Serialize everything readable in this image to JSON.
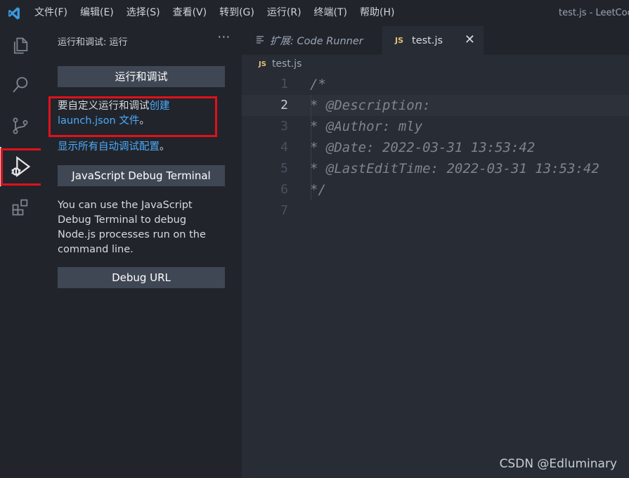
{
  "titlebar": {
    "menu": [
      "文件(F)",
      "编辑(E)",
      "选择(S)",
      "查看(V)",
      "转到(G)",
      "运行(R)",
      "终端(T)",
      "帮助(H)"
    ],
    "window_title": "test.js - LeetCode"
  },
  "activitybar": {
    "items": [
      "explorer-icon",
      "search-icon",
      "source-control-icon",
      "run-debug-icon",
      "extensions-icon"
    ],
    "active": "run-debug-icon"
  },
  "sidebar": {
    "title": "运行和调试: 运行",
    "more": "···",
    "run_button": "运行和调试",
    "customize_prefix": "要自定义运行和调试",
    "customize_link": "创建 launch.json 文件",
    "customize_suffix": "。",
    "show_all_link": "显示所有自动调试配置",
    "show_all_suffix": "。",
    "terminal_button": "JavaScript Debug Terminal",
    "terminal_desc": "You can use the JavaScript Debug Terminal to debug Node.js processes run on the command line.",
    "debug_url_button": "Debug URL"
  },
  "editor": {
    "tabs": [
      {
        "label": "扩展: Code Runner",
        "active": false
      },
      {
        "label": "test.js",
        "badge": "JS",
        "active": true
      }
    ],
    "breadcrumb": {
      "badge": "JS",
      "file": "test.js"
    },
    "current_line": 2,
    "lines": [
      {
        "n": "1",
        "text": "/*"
      },
      {
        "n": "2",
        "text": " * @Description:"
      },
      {
        "n": "3",
        "text": " * @Author: mly"
      },
      {
        "n": "4",
        "text": " * @Date: 2022-03-31 13:53:42"
      },
      {
        "n": "5",
        "text": " * @LastEditTime: 2022-03-31 13:53:42"
      },
      {
        "n": "6",
        "text": " */"
      },
      {
        "n": "7",
        "text": ""
      }
    ]
  },
  "watermark": "CSDN @Edluminary",
  "colors": {
    "accent_link": "#4daafc",
    "highlight_box": "#e0111b",
    "vscode_blue": "#3b9ae1"
  }
}
